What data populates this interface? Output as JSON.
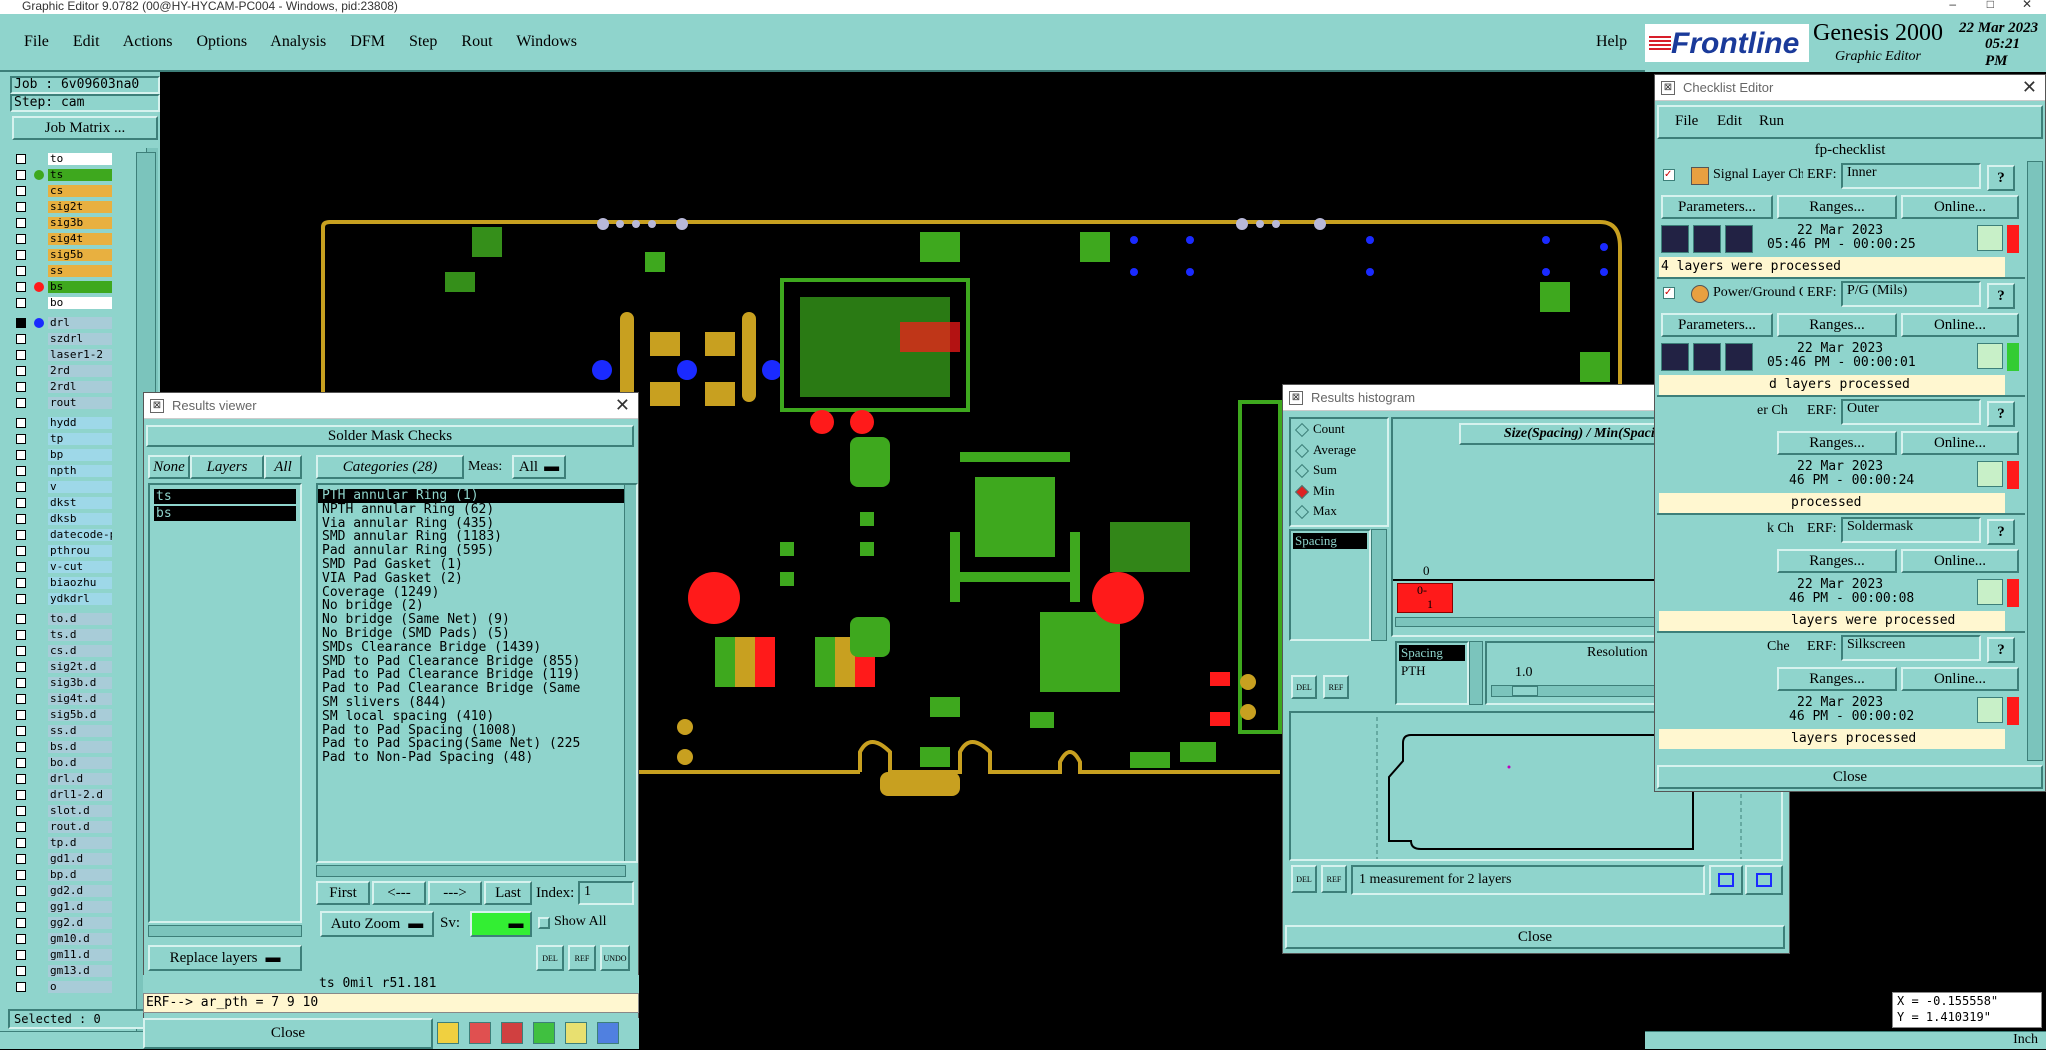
{
  "os_title": "Graphic Editor 9.0782 (00@HY-HYCAM-PC004 - Windows, pid:23808)",
  "menu": [
    "File",
    "Edit",
    "Actions",
    "Options",
    "Analysis",
    "DFM",
    "Step",
    "Rout",
    "Windows"
  ],
  "help": "Help",
  "brand": {
    "logo": "Frontline",
    "product": "Genesis 2000",
    "subtitle": "Graphic Editor",
    "date": "22 Mar 2023",
    "time": "05:21 PM"
  },
  "job": {
    "job": "Job : 6v09603na0",
    "step": "Step: cam",
    "matrix": "Job Matrix ..."
  },
  "layers": [
    "to",
    "ts",
    "cs",
    "sig2t",
    "sig3b",
    "sig4t",
    "sig5b",
    "ss",
    "bs",
    "bo",
    "drl",
    "szdrl",
    "laser1-2",
    "2rd",
    "2rdl",
    "rout",
    "hydd",
    "tp",
    "bp",
    "npth",
    "v",
    "dkst",
    "dksb",
    "datecode-pth",
    "pthrou",
    "v-cut",
    "biaozhu",
    "ydkdrl",
    "to.d",
    "ts.d",
    "cs.d",
    "sig2t.d",
    "sig3b.d",
    "sig4t.d",
    "sig5b.d",
    "ss.d",
    "bs.d",
    "bo.d",
    "drl.d",
    "drl1-2.d",
    "slot.d",
    "rout.d",
    "tp.d",
    "gd1.d",
    "bp.d",
    "gd2.d",
    "gg1.d",
    "gg2.d",
    "gm10.d",
    "gm11.d",
    "gm13.d",
    "o"
  ],
  "selected": "Selected : 0",
  "results_viewer": {
    "title": "Results viewer",
    "header": "Solder Mask Checks",
    "none": "None",
    "layers_btn": "Layers",
    "all": "All",
    "categories_btn": "Categories (28)",
    "meas_label": "Meas:",
    "meas_value": "All",
    "layer_list": [
      "ts",
      "bs"
    ],
    "categories": [
      "PTH annular Ring (1)",
      "NPTH annular Ring (62)",
      "Via annular Ring (435)",
      "SMD annular Ring (1183)",
      "Pad annular Ring (595)",
      "SMD Pad Gasket (1)",
      "VIA Pad Gasket (2)",
      "Coverage (1249)",
      "No bridge (2)",
      "No bridge (Same Net) (9)",
      "No Bridge (SMD Pads) (5)",
      "SMDs Clearance Bridge (1439)",
      "SMD to Pad Clearance Bridge (855)",
      "Pad to Pad Clearance Bridge (119)",
      "Pad to Pad Clearance Bridge (Same",
      "SM slivers (844)",
      "SM local spacing (410)",
      "Pad to Pad Spacing (1008)",
      "Pad to Pad Spacing(Same Net) (225",
      "Pad to Non-Pad Spacing (48)"
    ],
    "first": "First",
    "prev": "<---",
    "next": "--->",
    "last": "Last",
    "index_label": "Index:",
    "index_value": "1",
    "auto_zoom": "Auto Zoom",
    "sv_label": "Sv:",
    "show_all": "Show All",
    "replace_layers": "Replace layers",
    "status": "ts 0mil   r51.181",
    "erf": "ERF--> ar_pth = 7 9 10",
    "close": "Close",
    "del": "DEL",
    "ref": "REF",
    "undo": "UNDO"
  },
  "histogram": {
    "title": "Results histogram",
    "modes": [
      "Count",
      "Average",
      "Sum",
      "Min",
      "Max"
    ],
    "selected_mode": "Min",
    "list_item": "Spacing",
    "formula": "Size(Spacing) / Min(Spacing)",
    "axis_zero": "0",
    "bar_label_top": "0-",
    "bar_label_bottom": "1",
    "spacing": "Spacing",
    "pth": "PTH",
    "resolution": "Resolution",
    "res_value": "1.0",
    "info": "1 measurement for 2 layers",
    "close": "Close",
    "del": "DEL",
    "ref": "REF"
  },
  "checklist": {
    "title": "Checklist Editor",
    "menu": [
      "File",
      "Edit",
      "Run"
    ],
    "name": "fp-checklist",
    "blocks": [
      {
        "title": "Signal Layer Ch",
        "erf_label": "ERF:",
        "erf": "Inner",
        "params": "Parameters...",
        "ranges": "Ranges...",
        "online": "Online...",
        "date": "22 Mar 2023",
        "time": "05:46 PM - 00:00:25",
        "status": "4 layers were processed"
      },
      {
        "title": "Power/Ground C",
        "erf_label": "ERF:",
        "erf": "P/G (Mils)",
        "params": "Parameters...",
        "ranges": "Ranges...",
        "online": "Online...",
        "date": "22 Mar 2023",
        "time": "05:46 PM - 00:00:01",
        "status": "d layers processed"
      },
      {
        "title": "er Ch",
        "erf_label": "ERF:",
        "erf": "Outer",
        "params": "",
        "ranges": "Ranges...",
        "online": "Online...",
        "date": "22 Mar 2023",
        "time": "46 PM - 00:00:24",
        "status": "processed"
      },
      {
        "title": "k Ch",
        "erf_label": "ERF:",
        "erf": "Soldermask",
        "params": "",
        "ranges": "Ranges...",
        "online": "Online...",
        "date": "22 Mar 2023",
        "time": "46 PM - 00:00:08",
        "status": "layers were processed"
      },
      {
        "title": "Che",
        "erf_label": "ERF:",
        "erf": "Silkscreen",
        "params": "",
        "ranges": "Ranges...",
        "online": "Online...",
        "date": "22 Mar 2023",
        "time": "46 PM - 00:00:02",
        "status": "layers processed"
      }
    ],
    "close": "Close"
  },
  "coords": {
    "x": "X = -0.155558\"",
    "y": "Y = 1.410319\""
  },
  "inch": "Inch",
  "colors": {
    "panel": "#8fd4cc",
    "pcb_green": "#3ea81e",
    "outline": "#c8a020",
    "error_red": "#ff1a1a",
    "via_blue": "#1a2aff"
  }
}
